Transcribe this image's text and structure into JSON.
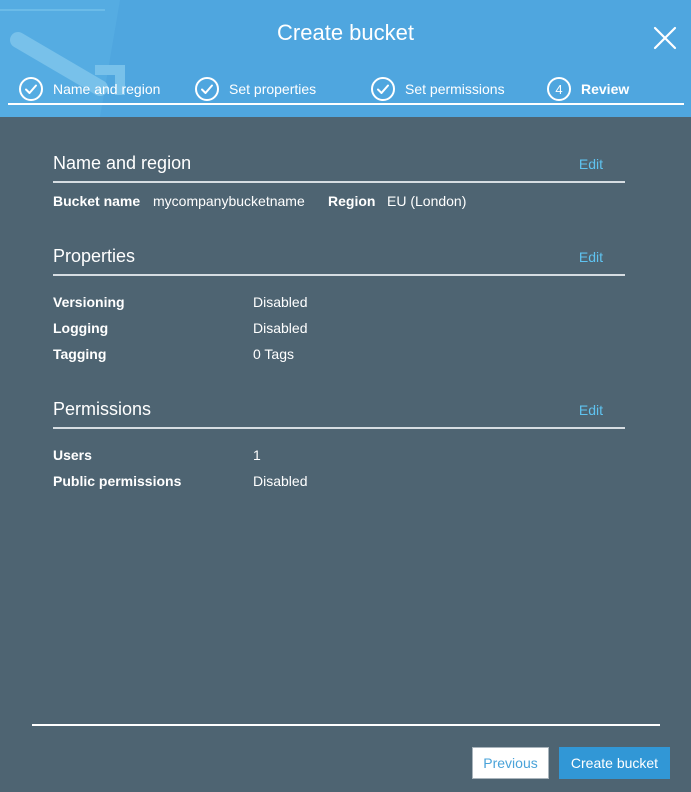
{
  "dialog": {
    "title": "Create bucket"
  },
  "steps": [
    {
      "label": "Name and region",
      "state": "complete",
      "icon": "check-icon"
    },
    {
      "label": "Set properties",
      "state": "complete",
      "icon": "check-icon"
    },
    {
      "label": "Set permissions",
      "state": "complete",
      "icon": "check-icon"
    },
    {
      "number": "4",
      "label": "Review",
      "state": "active"
    }
  ],
  "sections": {
    "name_region": {
      "title": "Name and region",
      "edit": "Edit",
      "bucket_name_label": "Bucket name",
      "bucket_name_value": "mycompanybucketname",
      "region_label": "Region",
      "region_value": "EU (London)"
    },
    "properties": {
      "title": "Properties",
      "edit": "Edit",
      "rows": [
        {
          "label": "Versioning",
          "value": "Disabled"
        },
        {
          "label": "Logging",
          "value": "Disabled"
        },
        {
          "label": "Tagging",
          "value": "0 Tags"
        }
      ]
    },
    "permissions": {
      "title": "Permissions",
      "edit": "Edit",
      "rows": [
        {
          "label": "Users",
          "value": "1"
        },
        {
          "label": "Public permissions",
          "value": "Disabled"
        }
      ]
    }
  },
  "footer": {
    "previous": "Previous",
    "create": "Create bucket"
  },
  "colors": {
    "header": "#4fa6df",
    "body": "#4e6472",
    "link": "#5fc3f0",
    "primary": "#3197d6"
  }
}
